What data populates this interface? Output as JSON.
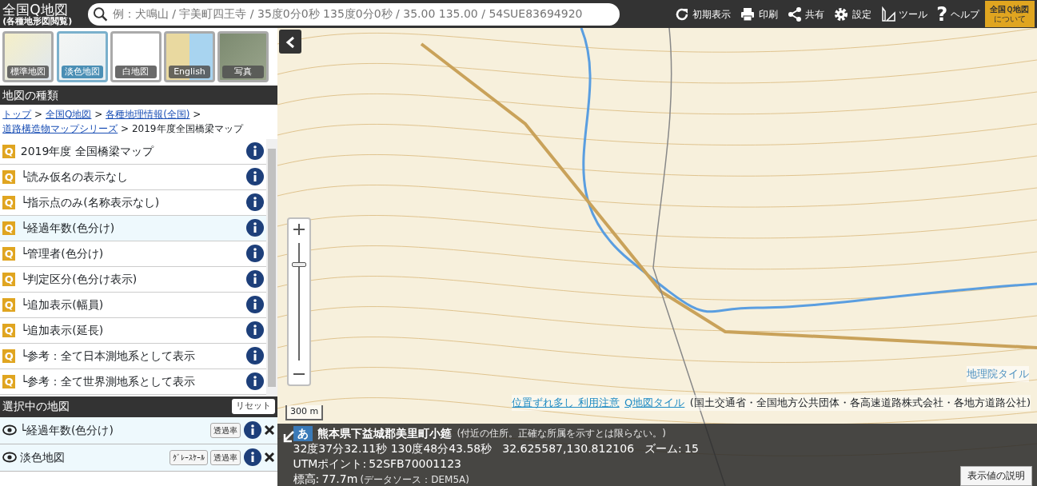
{
  "header": {
    "logo_title": "全国Q地図",
    "logo_subtitle": "(各種地形図閲覧)",
    "search": {
      "placeholder": "例：犬鳴山 / 宇美町四王寺 / 35度0分0秒 135度0分0秒 / 35.00 135.00 / 54SUE83694920"
    },
    "tools": [
      {
        "kind": "reset",
        "label": "初期表示"
      },
      {
        "kind": "print",
        "label": "印刷"
      },
      {
        "kind": "share",
        "label": "共有"
      },
      {
        "kind": "settings",
        "label": "設定"
      },
      {
        "kind": "tool",
        "label": "ツール"
      },
      {
        "kind": "help",
        "icon": "?",
        "label": "ヘルプ"
      }
    ],
    "about": {
      "line1": "全国Ｑ地図",
      "line2": "について"
    }
  },
  "basemaps": [
    {
      "kind": "standard",
      "label": "標準地図",
      "selected": false
    },
    {
      "kind": "pale",
      "label": "淡色地図",
      "selected": true
    },
    {
      "kind": "blank",
      "label": "白地図",
      "selected": false
    },
    {
      "kind": "english",
      "label": "English",
      "selected": false
    },
    {
      "kind": "photo",
      "label": "写真",
      "selected": false
    }
  ],
  "map_types": {
    "title": "地図の種類",
    "breadcrumb": [
      {
        "label": "トップ",
        "link": true,
        "sep": ">"
      },
      {
        "label": "全国Q地図",
        "link": true,
        "sep": ">"
      },
      {
        "label": "各種地理情報(全国)",
        "link": true,
        "sep": ">"
      },
      {
        "label": "道路構造物マップシリーズ",
        "link": true,
        "sep": ">"
      },
      {
        "label": "2019年度全国橋梁マップ",
        "link": false
      }
    ],
    "items": [
      {
        "badge": "Q",
        "label": "2019年度 全国橋梁マップ",
        "selected": false
      },
      {
        "badge": "Q",
        "label": "└読み仮名の表示なし",
        "selected": false
      },
      {
        "badge": "Q",
        "label": "└指示点のみ(名称表示なし)",
        "selected": false
      },
      {
        "badge": "Q",
        "label": "└経過年数(色分け)",
        "selected": true
      },
      {
        "badge": "Q",
        "label": "└管理者(色分け)",
        "selected": false
      },
      {
        "badge": "Q",
        "label": "└判定区分(色分け表示)",
        "selected": false
      },
      {
        "badge": "Q",
        "label": "└追加表示(幅員)",
        "selected": false
      },
      {
        "badge": "Q",
        "label": "└追加表示(延長)",
        "selected": false
      },
      {
        "badge": "Q",
        "label": "└参考：全て日本測地系として表示",
        "selected": false
      },
      {
        "badge": "Q",
        "label": "└参考：全て世界測地系として表示",
        "selected": false
      }
    ]
  },
  "selected_maps": {
    "title": "選択中の地図",
    "reset": "リセット",
    "items": [
      {
        "label": "└経過年数(色分け)",
        "opacity": "透過率"
      },
      {
        "label": "淡色地図",
        "grayscale": "ｸﾞﾚｰｽｹｰﾙ",
        "opacity": "透過率"
      }
    ]
  },
  "map": {
    "zoom_slider": {
      "level": 0.82
    },
    "scale": "300 m",
    "attribution": [
      {
        "text": "位置ずれ多し 利用注意",
        "link": true
      },
      {
        "text": "Q地図タイル",
        "link": true
      },
      {
        "text": "(国土交通省・全国地方公共団体・各高速道路株式会社・各地方道路公社)",
        "link": false
      }
    ],
    "tile_credit": "地理院タイル"
  },
  "info": {
    "lang_badge": "あ",
    "address": "熊本県下益城郡美里町小筵",
    "address_note": "(付近の住所。正確な所属を示すとは限らない。)",
    "dms": "32度37分32.11秒 130度48分43.58秒",
    "decimal": "32.625587,130.812106",
    "zoom_label": "ズーム:",
    "zoom": "15",
    "utm_label": "UTMポイント:",
    "utm": "52SFB70001123",
    "elev_label": "標高:",
    "elev": "77.7m",
    "elev_note": "(データソース：DEM5A)",
    "explain_button": "表示値の説明"
  }
}
